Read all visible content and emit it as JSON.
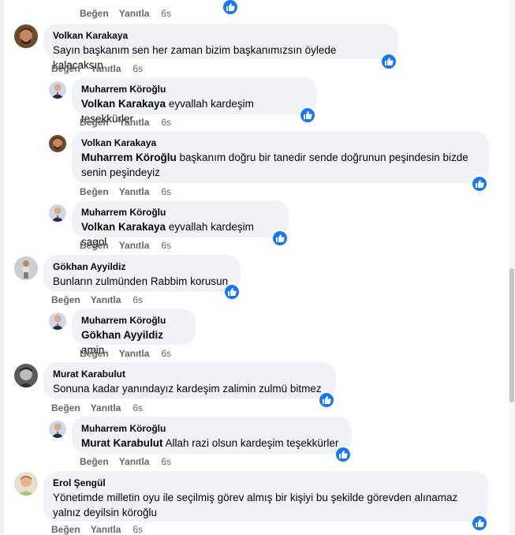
{
  "labels": {
    "like": "Beğen",
    "reply": "Yanıtla"
  },
  "top_actions": {
    "time": "6s"
  },
  "comments": [
    {
      "author": "Volkan Karakaya",
      "mention": "",
      "text": "Sayın başkanım sen her zaman bizim başkanımızsın öylede kalacaksın",
      "time": "6s"
    },
    {
      "author": "Muharrem Köroğlu",
      "mention": "Volkan Karakaya",
      "text": "eyvallah kardeşim teşekkürler",
      "time": "6s"
    },
    {
      "author": "Volkan Karakaya",
      "mention": "Muharrem Köroğlu",
      "text": "başkanım doğru bir tanedir sende doğrunun peşindesin bizde",
      "text2": "senin peşindeyiz",
      "time": "6s"
    },
    {
      "author": "Muharrem Köroğlu",
      "mention": "Volkan Karakaya",
      "text": "eyvallah kardeşim sagol",
      "time": "6s"
    },
    {
      "author": "Gökhan Ayyildiz",
      "mention": "",
      "text": "Bunların zulmünden Rabbim korusun",
      "time": "6s"
    },
    {
      "author": "Muharrem Köroğlu",
      "mention": "Gökhan Ayyildiz",
      "text": "amin",
      "time": "6s"
    },
    {
      "author": "Murat Karabulut",
      "mention": "",
      "text": "Sonuna kadar yanındayız kardeşim zalimin zulmü bitmez",
      "time": "6s"
    },
    {
      "author": "Muharrem Köroğlu",
      "mention": "Murat Karabulut",
      "text": "Allah razi olsun kardeşim teşekkürler",
      "time": "6s"
    },
    {
      "author": "Erol Şengül",
      "mention": "",
      "text": "Yönetimde milletin oyu ile seçilmiş görev almış bir kişiyi bu şekilde görevden alınamaz",
      "text2": "yalnız deyilsin köroğlu",
      "time": "6s"
    }
  ],
  "colors": {
    "bubble": "#f0f2f5",
    "like_blue": "#1877f2",
    "meta_gray": "#65676b"
  }
}
